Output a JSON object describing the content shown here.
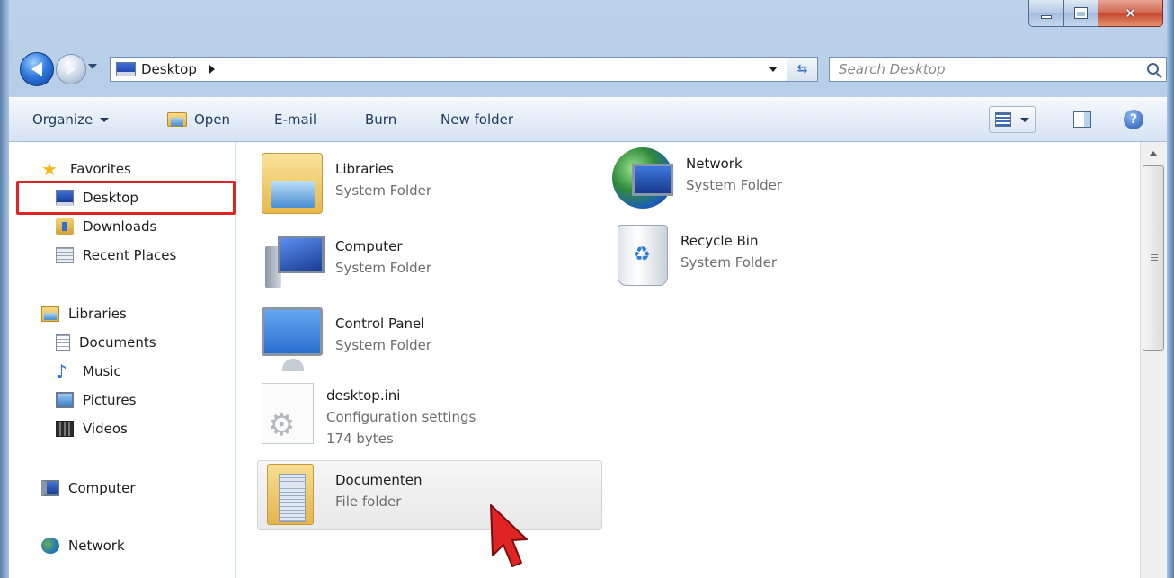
{
  "window": {
    "title": "Desktop"
  },
  "address_bar": {
    "location": "Desktop",
    "search_placeholder": "Search Desktop"
  },
  "command_bar": {
    "organize": "Organize",
    "open": "Open",
    "email": "E-mail",
    "burn": "Burn",
    "new_folder": "New folder",
    "help": "?"
  },
  "sidebar": {
    "favorites": "Favorites",
    "desktop": "Desktop",
    "downloads": "Downloads",
    "recent_places": "Recent Places",
    "libraries": "Libraries",
    "documents": "Documents",
    "music": "Music",
    "pictures": "Pictures",
    "videos": "Videos",
    "computer": "Computer",
    "network": "Network"
  },
  "items": {
    "libraries": {
      "name": "Libraries",
      "type": "System Folder"
    },
    "network": {
      "name": "Network",
      "type": "System Folder"
    },
    "computer": {
      "name": "Computer",
      "type": "System Folder"
    },
    "recycle_bin": {
      "name": "Recycle Bin",
      "type": "System Folder"
    },
    "control_panel": {
      "name": "Control Panel",
      "type": "System Folder"
    },
    "desktop_ini": {
      "name": "desktop.ini",
      "type": "Configuration settings",
      "size": "174 bytes"
    },
    "documenten": {
      "name": "Documenten",
      "type": "File folder"
    }
  },
  "colors": {
    "highlight": "#e02424",
    "cursor": "#e02424",
    "frame": "#a9c4e2"
  }
}
